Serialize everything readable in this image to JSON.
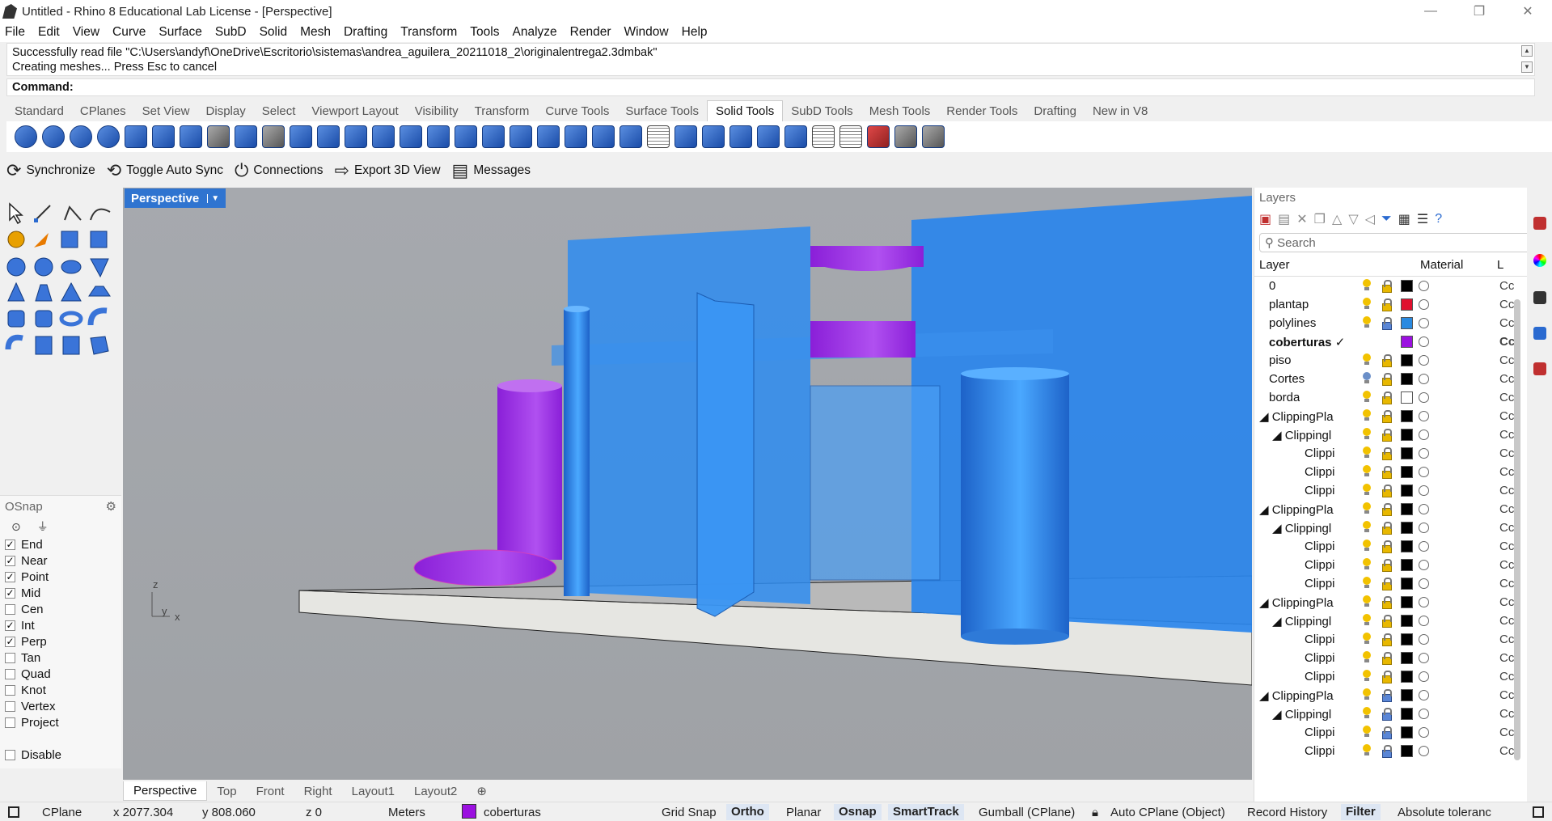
{
  "window": {
    "title": "Untitled - Rhino 8 Educational Lab License - [Perspective]",
    "minimize": "—",
    "restore": "❐",
    "close": "✕"
  },
  "menu": [
    "File",
    "Edit",
    "View",
    "Curve",
    "Surface",
    "SubD",
    "Solid",
    "Mesh",
    "Drafting",
    "Transform",
    "Tools",
    "Analyze",
    "Render",
    "Window",
    "Help"
  ],
  "history": {
    "line1": "Successfully read file \"C:\\Users\\andyf\\OneDrive\\Escritorio\\sistemas\\andrea_aguilera_20211018_2\\originalentrega2.3dmbak\"",
    "line2": "Creating meshes... Press Esc to cancel"
  },
  "command": {
    "label": "Command:"
  },
  "tabs": [
    "Standard",
    "CPlanes",
    "Set View",
    "Display",
    "Select",
    "Viewport Layout",
    "Visibility",
    "Transform",
    "Curve Tools",
    "Surface Tools",
    "Solid Tools",
    "SubD Tools",
    "Mesh Tools",
    "Render Tools",
    "Drafting",
    "New in V8"
  ],
  "active_tab": "Solid Tools",
  "secondary": {
    "synchronize": "Synchronize",
    "toggle": "Toggle Auto Sync",
    "connections": "Connections",
    "export": "Export 3D View",
    "messages": "Messages"
  },
  "osnap": {
    "title": "OSnap",
    "items": [
      {
        "label": "End",
        "checked": "✓"
      },
      {
        "label": "Near",
        "checked": "✓"
      },
      {
        "label": "Point",
        "checked": "✓"
      },
      {
        "label": "Mid",
        "checked": "✓"
      },
      {
        "label": "Cen",
        "checked": ""
      },
      {
        "label": "Int",
        "checked": "✓"
      },
      {
        "label": "Perp",
        "checked": "✓"
      },
      {
        "label": "Tan",
        "checked": ""
      },
      {
        "label": "Quad",
        "checked": ""
      },
      {
        "label": "Knot",
        "checked": ""
      },
      {
        "label": "Vertex",
        "checked": ""
      },
      {
        "label": "Project",
        "checked": ""
      }
    ],
    "disable": "Disable"
  },
  "viewport": {
    "name": "Perspective",
    "axis_z": "z",
    "axis_y": "y",
    "axis_x": "x"
  },
  "bottom_tabs": [
    "Perspective",
    "Top",
    "Front",
    "Right",
    "Layout1",
    "Layout2"
  ],
  "layers": {
    "title": "Layers",
    "search_placeholder": "Search",
    "col_layer": "Layer",
    "col_material": "Material",
    "col_l": "L",
    "rows": [
      {
        "name": "0",
        "indent": 0,
        "color": "#000000",
        "bulb": "on",
        "lock": "open",
        "co": "Cc"
      },
      {
        "name": "plantap",
        "indent": 0,
        "color": "#e0102e",
        "bulb": "on",
        "lock": "open",
        "co": "Cc"
      },
      {
        "name": "polylines",
        "indent": 0,
        "color": "#2a8ae0",
        "bulb": "on",
        "lock": "locked",
        "co": "Cc"
      },
      {
        "name": "coberturas ✓",
        "indent": 0,
        "color": "#9b10e0",
        "bulb": "none",
        "lock": "none",
        "co": "Cc",
        "bold": true
      },
      {
        "name": "piso",
        "indent": 0,
        "color": "#000000",
        "bulb": "on",
        "lock": "open",
        "co": "Cc"
      },
      {
        "name": "Cortes",
        "indent": 0,
        "color": "#000000",
        "bulb": "off",
        "lock": "open",
        "co": "Cc"
      },
      {
        "name": "borda",
        "indent": 0,
        "color": "#ffffff",
        "bulb": "on",
        "lock": "open",
        "co": "Cc"
      },
      {
        "name": "◢ ClippingPla",
        "indent": 0,
        "color": "#000000",
        "bulb": "on",
        "lock": "open",
        "co": "Cc"
      },
      {
        "name": "◢ Clippingl",
        "indent": 1,
        "color": "#000000",
        "bulb": "on",
        "lock": "open",
        "co": "Cc"
      },
      {
        "name": "Clippi",
        "indent": 2,
        "color": "#000000",
        "bulb": "on",
        "lock": "open",
        "co": "Cc"
      },
      {
        "name": "Clippi",
        "indent": 2,
        "color": "#000000",
        "bulb": "on",
        "lock": "open",
        "co": "Cc"
      },
      {
        "name": "Clippi",
        "indent": 2,
        "color": "#000000",
        "bulb": "on",
        "lock": "open",
        "co": "Cc"
      },
      {
        "name": "◢ ClippingPla",
        "indent": 0,
        "color": "#000000",
        "bulb": "on",
        "lock": "open",
        "co": "Cc"
      },
      {
        "name": "◢ Clippingl",
        "indent": 1,
        "color": "#000000",
        "bulb": "on",
        "lock": "open",
        "co": "Cc"
      },
      {
        "name": "Clippi",
        "indent": 2,
        "color": "#000000",
        "bulb": "on",
        "lock": "open",
        "co": "Cc"
      },
      {
        "name": "Clippi",
        "indent": 2,
        "color": "#000000",
        "bulb": "on",
        "lock": "open",
        "co": "Cc"
      },
      {
        "name": "Clippi",
        "indent": 2,
        "color": "#000000",
        "bulb": "on",
        "lock": "open",
        "co": "Cc"
      },
      {
        "name": "◢ ClippingPla",
        "indent": 0,
        "color": "#000000",
        "bulb": "on",
        "lock": "open",
        "co": "Cc"
      },
      {
        "name": "◢ Clippingl",
        "indent": 1,
        "color": "#000000",
        "bulb": "on",
        "lock": "open",
        "co": "Cc"
      },
      {
        "name": "Clippi",
        "indent": 2,
        "color": "#000000",
        "bulb": "on",
        "lock": "open",
        "co": "Cc"
      },
      {
        "name": "Clippi",
        "indent": 2,
        "color": "#000000",
        "bulb": "on",
        "lock": "open",
        "co": "Cc"
      },
      {
        "name": "Clippi",
        "indent": 2,
        "color": "#000000",
        "bulb": "on",
        "lock": "open",
        "co": "Cc"
      },
      {
        "name": "◢ ClippingPla",
        "indent": 0,
        "color": "#000000",
        "bulb": "on",
        "lock": "locked",
        "co": "Cc"
      },
      {
        "name": "◢ Clippingl",
        "indent": 1,
        "color": "#000000",
        "bulb": "on",
        "lock": "locked",
        "co": "Cc"
      },
      {
        "name": "Clippi",
        "indent": 2,
        "color": "#000000",
        "bulb": "on",
        "lock": "locked",
        "co": "Cc"
      },
      {
        "name": "Clippi",
        "indent": 2,
        "color": "#000000",
        "bulb": "on",
        "lock": "locked",
        "co": "Cc"
      }
    ]
  },
  "status": {
    "cplane": "CPlane",
    "x": "x 2077.304",
    "y": "y 808.060",
    "z": "z 0",
    "units": "Meters",
    "layer": "coberturas",
    "layer_color": "#9b10e0",
    "grid_snap": "Grid Snap",
    "ortho": "Ortho",
    "planar": "Planar",
    "osnap": "Osnap",
    "smarttrack": "SmartTrack",
    "gumball": "Gumball (CPlane)",
    "auto_cplane": "Auto CPlane (Object)",
    "record": "Record History",
    "filter": "Filter",
    "tolerance": "Absolute toleranc"
  }
}
